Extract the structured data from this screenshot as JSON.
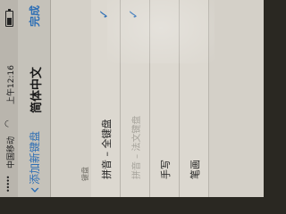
{
  "status_bar": {
    "signal": "•••••",
    "carrier": "中国移动",
    "time": "上午12:16",
    "battery_level": 0.55
  },
  "nav": {
    "back_label": "添加新键盘",
    "title": "简体中文",
    "done_label": "完成"
  },
  "section": {
    "header": "键盘"
  },
  "keyboards": [
    {
      "label": "拼音 – 全键盘",
      "checked": true
    },
    {
      "label": "拼音 – 法文键盘",
      "checked": true
    },
    {
      "label": "手写",
      "checked": false
    },
    {
      "label": "笔画",
      "checked": false
    }
  ],
  "colors": {
    "accent": "#2e6fb5",
    "background": "#d4d0c8"
  },
  "icons": {
    "back": "chevron-left-icon",
    "check": "check-icon",
    "wifi": "wifi-icon",
    "battery": "battery-icon"
  }
}
